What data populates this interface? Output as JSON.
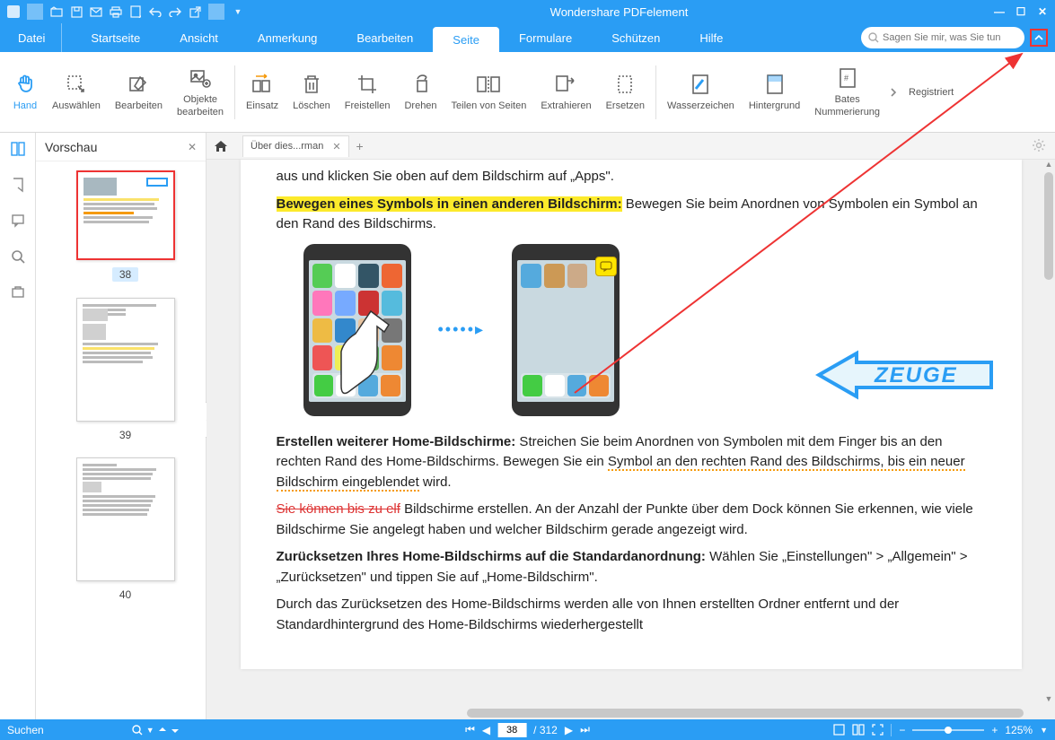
{
  "app": {
    "title": "Wondershare PDFelement"
  },
  "menu": {
    "file": "Datei",
    "items": [
      "Startseite",
      "Ansicht",
      "Anmerkung",
      "Bearbeiten",
      "Seite",
      "Formulare",
      "Schützen",
      "Hilfe"
    ],
    "active_index": 4,
    "search_placeholder": "Sagen Sie mir, was Sie tun"
  },
  "ribbon": {
    "tools": [
      {
        "label": "Hand",
        "icon": "hand",
        "active": true
      },
      {
        "label": "Auswählen",
        "icon": "select"
      },
      {
        "label": "Bearbeiten",
        "icon": "edit"
      },
      {
        "label": "Objekte\nbearbeiten",
        "icon": "objedit"
      }
    ],
    "tools2": [
      {
        "label": "Einsatz",
        "icon": "insert"
      },
      {
        "label": "Löschen",
        "icon": "delete"
      },
      {
        "label": "Freistellen",
        "icon": "crop"
      },
      {
        "label": "Drehen",
        "icon": "rotate"
      },
      {
        "label": "Teilen von Seiten",
        "icon": "split"
      },
      {
        "label": "Extrahieren",
        "icon": "extract"
      },
      {
        "label": "Ersetzen",
        "icon": "replace"
      }
    ],
    "tools3": [
      {
        "label": "Wasserzeichen",
        "icon": "watermark"
      },
      {
        "label": "Hintergrund",
        "icon": "background"
      },
      {
        "label": "Bates\nNummerierung",
        "icon": "bates"
      }
    ],
    "registered": "Registriert"
  },
  "sidebar": {
    "title": "Vorschau",
    "thumbs": [
      {
        "num": "38",
        "active": true
      },
      {
        "num": "39",
        "active": false
      },
      {
        "num": "40",
        "active": false
      }
    ]
  },
  "tabs": {
    "doc_name": "Über dies...rman"
  },
  "document": {
    "line1": "aus und klicken Sie oben auf dem Bildschirm auf „Apps\".",
    "hl1": "Bewegen eines Symbols in einen anderen Bildschirm:",
    "line2": " Bewegen Sie beim Anordnen von Symbolen ein Symbol an den Rand des Bildschirms.",
    "stamp": "ZEUGE",
    "bold2": "Erstellen weiterer Home-Bildschirme:",
    "line3a": " Streichen Sie beim Anordnen von Symbolen mit dem Finger bis an den rechten Rand des Home-Bildschirms. Bewegen Sie ein ",
    "underwave": "Symbol an den rechten Rand des Bildschirms, bis ein neuer Bildschirm eingeblendet",
    "line3b": " wird.",
    "strike": "Sie können bis zu elf",
    "line4": " Bildschirme erstellen. An der Anzahl der Punkte über dem Dock können Sie erkennen, wie viele Bildschirme Sie angelegt haben und welcher Bildschirm gerade angezeigt wird.",
    "bold3": "Zurücksetzen Ihres Home-Bildschirms auf die Standardanordnung:",
    "line5": " Wählen Sie „Einstellungen\" > „Allgemein\" > „Zurücksetzen\" und tippen Sie auf „Home-Bildschirm\".",
    "line6": "Durch das Zurücksetzen des Home-Bildschirms werden alle von Ihnen erstellten Ordner entfernt und der Standardhintergrund des Home-Bildschirms wiederhergestellt"
  },
  "status": {
    "search": "Suchen",
    "page": "38",
    "total": "/ 312",
    "zoom": "125%"
  }
}
